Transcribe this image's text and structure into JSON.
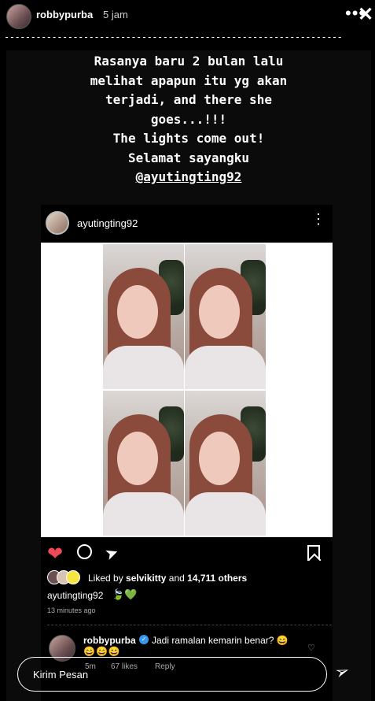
{
  "header": {
    "username": "robbypurba",
    "time": "5 jam",
    "more_icon": "more-horizontal-icon",
    "close_icon": "close-icon",
    "dashes": "----------------------------------------------------------------"
  },
  "caption": {
    "lines": [
      "Rasanya baru 2 bulan lalu",
      "melihat apapun itu yg akan",
      "terjadi, and there she",
      "goes...!!!",
      "The lights come out!",
      "Selamat sayangku"
    ],
    "mention": "@ayutingting92"
  },
  "post": {
    "username": "ayutingting92",
    "liked_by_prefix": "Liked by",
    "liked_by_user": "selvikitty",
    "liked_by_and": "and",
    "liked_by_count": "14,711 others",
    "caption_user": "ayutingting92",
    "caption_emoji": "🍃💚",
    "time_ago": "13 minutes ago",
    "heart_color": "#ed4956"
  },
  "comment": {
    "username": "robbypurba",
    "text": "Jadi ramalan kemarin benar? 😄",
    "emoji_line": "😄😄😄",
    "age": "5m",
    "likes": "67 likes",
    "reply": "Reply"
  },
  "message": {
    "placeholder": "Kirim Pesan"
  }
}
